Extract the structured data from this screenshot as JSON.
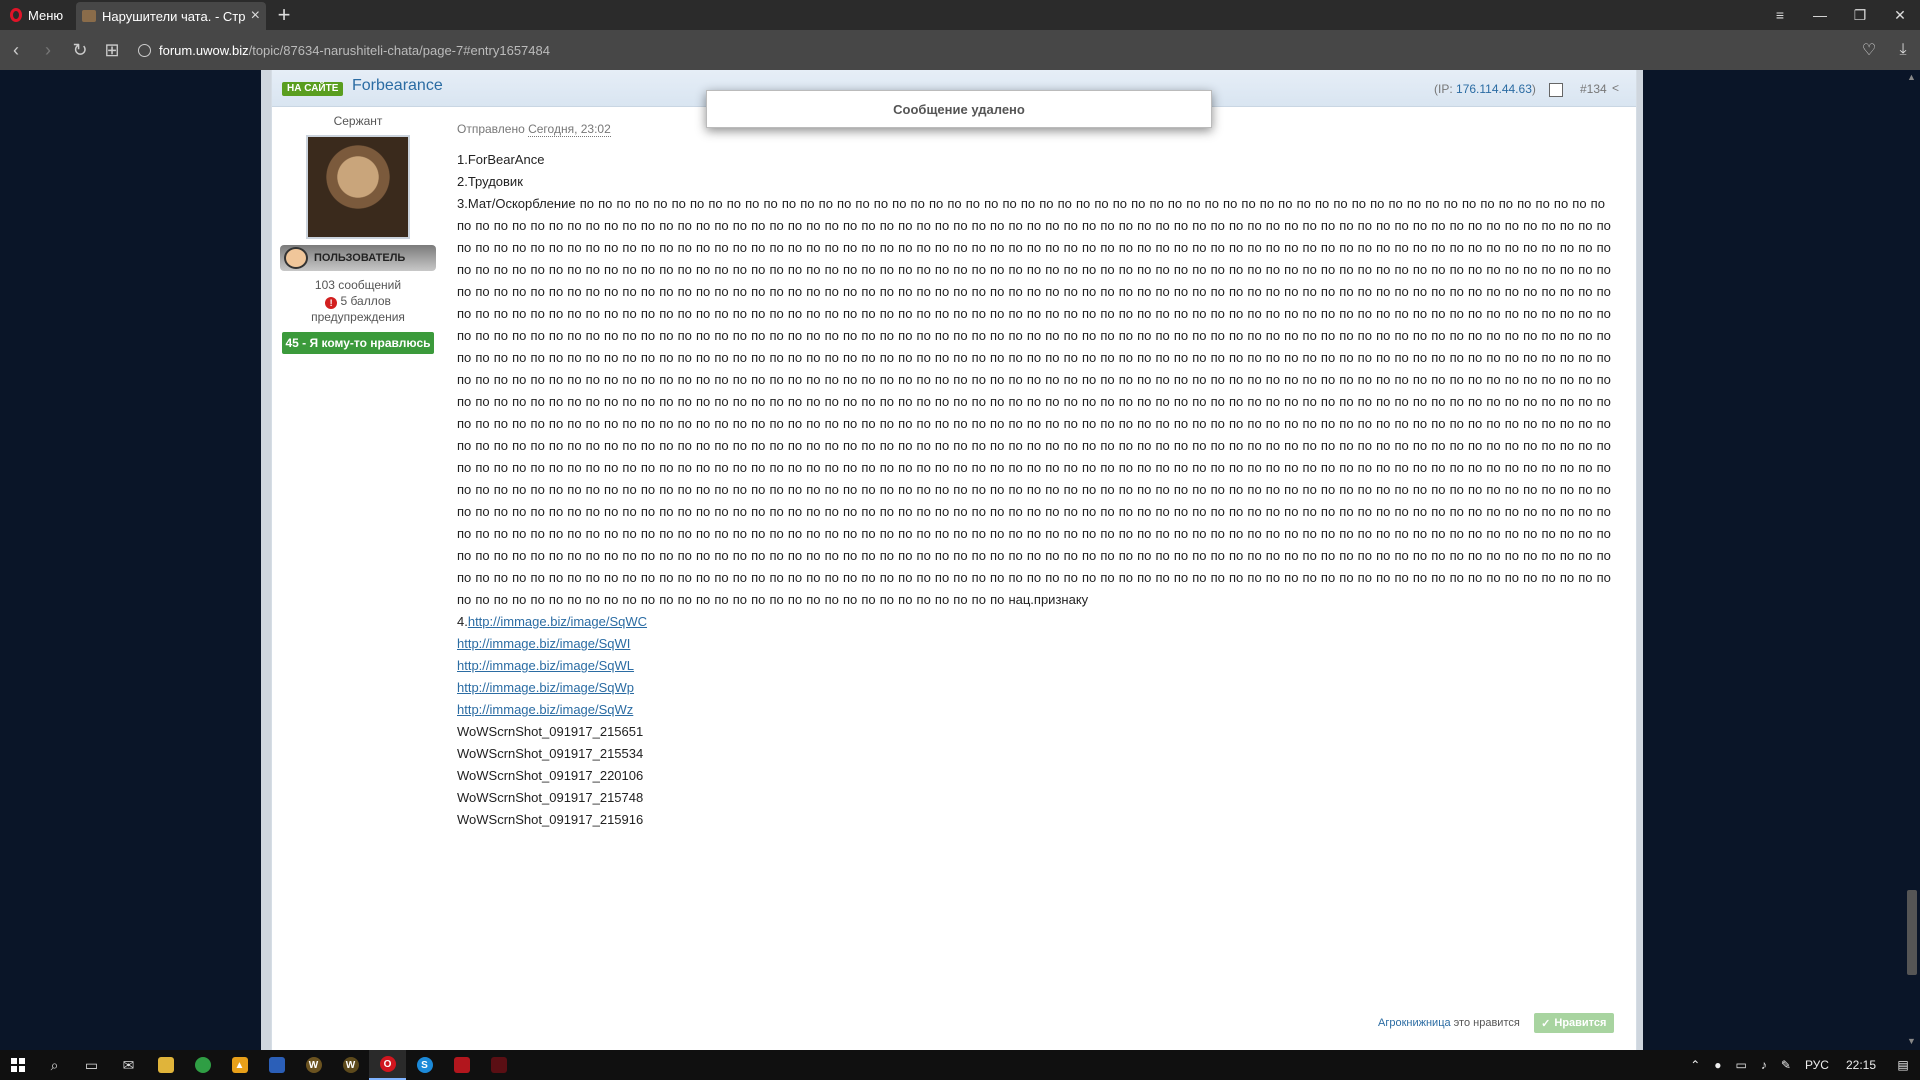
{
  "browser": {
    "menu_label": "Меню",
    "tab_title": "Нарушители чата. - Стра",
    "url_domain": "forum.uwow.biz",
    "url_path": "/topic/87634-narushiteli-chata/page-7#entry1657484"
  },
  "post": {
    "online_badge": "НА САЙТЕ",
    "author": "Forbearance",
    "ip_label": "(IP: ",
    "ip_value": "176.114.44.63",
    "ip_close": ")",
    "number": "#134",
    "deleted_notice": "Сообщение удалено",
    "date_label": "Отправлено ",
    "date_value": "Сегодня, 23:02",
    "lines": {
      "name": "1.ForBearAnce",
      "class": "2.Трудовик",
      "reason_prefix": "3.Мат/Оскорбление по по по по  ",
      "reason_suffix": " по нац.признаку",
      "link_prefix": "4."
    },
    "filler_word": "по",
    "filler_count": 1152,
    "links": [
      "http://immage.biz/image/SqWC",
      "http://immage.biz/image/SqWI",
      "http://immage.biz/image/SqWL",
      "http://immage.biz/image/SqWp",
      "http://immage.biz/image/SqWz"
    ],
    "screenshots": [
      "WoWScrnShot_091917_215651",
      "WoWScrnShot_091917_215534",
      "WoWScrnShot_091917_220106",
      "WoWScrnShot_091917_215748",
      "WoWScrnShot_091917_215916"
    ],
    "liker": "Агрокнижница",
    "likes_suffix": " это нравится",
    "like_button": "Нравится"
  },
  "author_info": {
    "rank": "Сержант",
    "group": "ПОЛЬЗОВАТЕЛЬ",
    "posts": "103 сообщений",
    "warnings": "5 баллов предупреждения",
    "reputation": "45 - Я кому-то нравлюсь"
  },
  "taskbar": {
    "language": "РУС",
    "time": "22:15"
  }
}
